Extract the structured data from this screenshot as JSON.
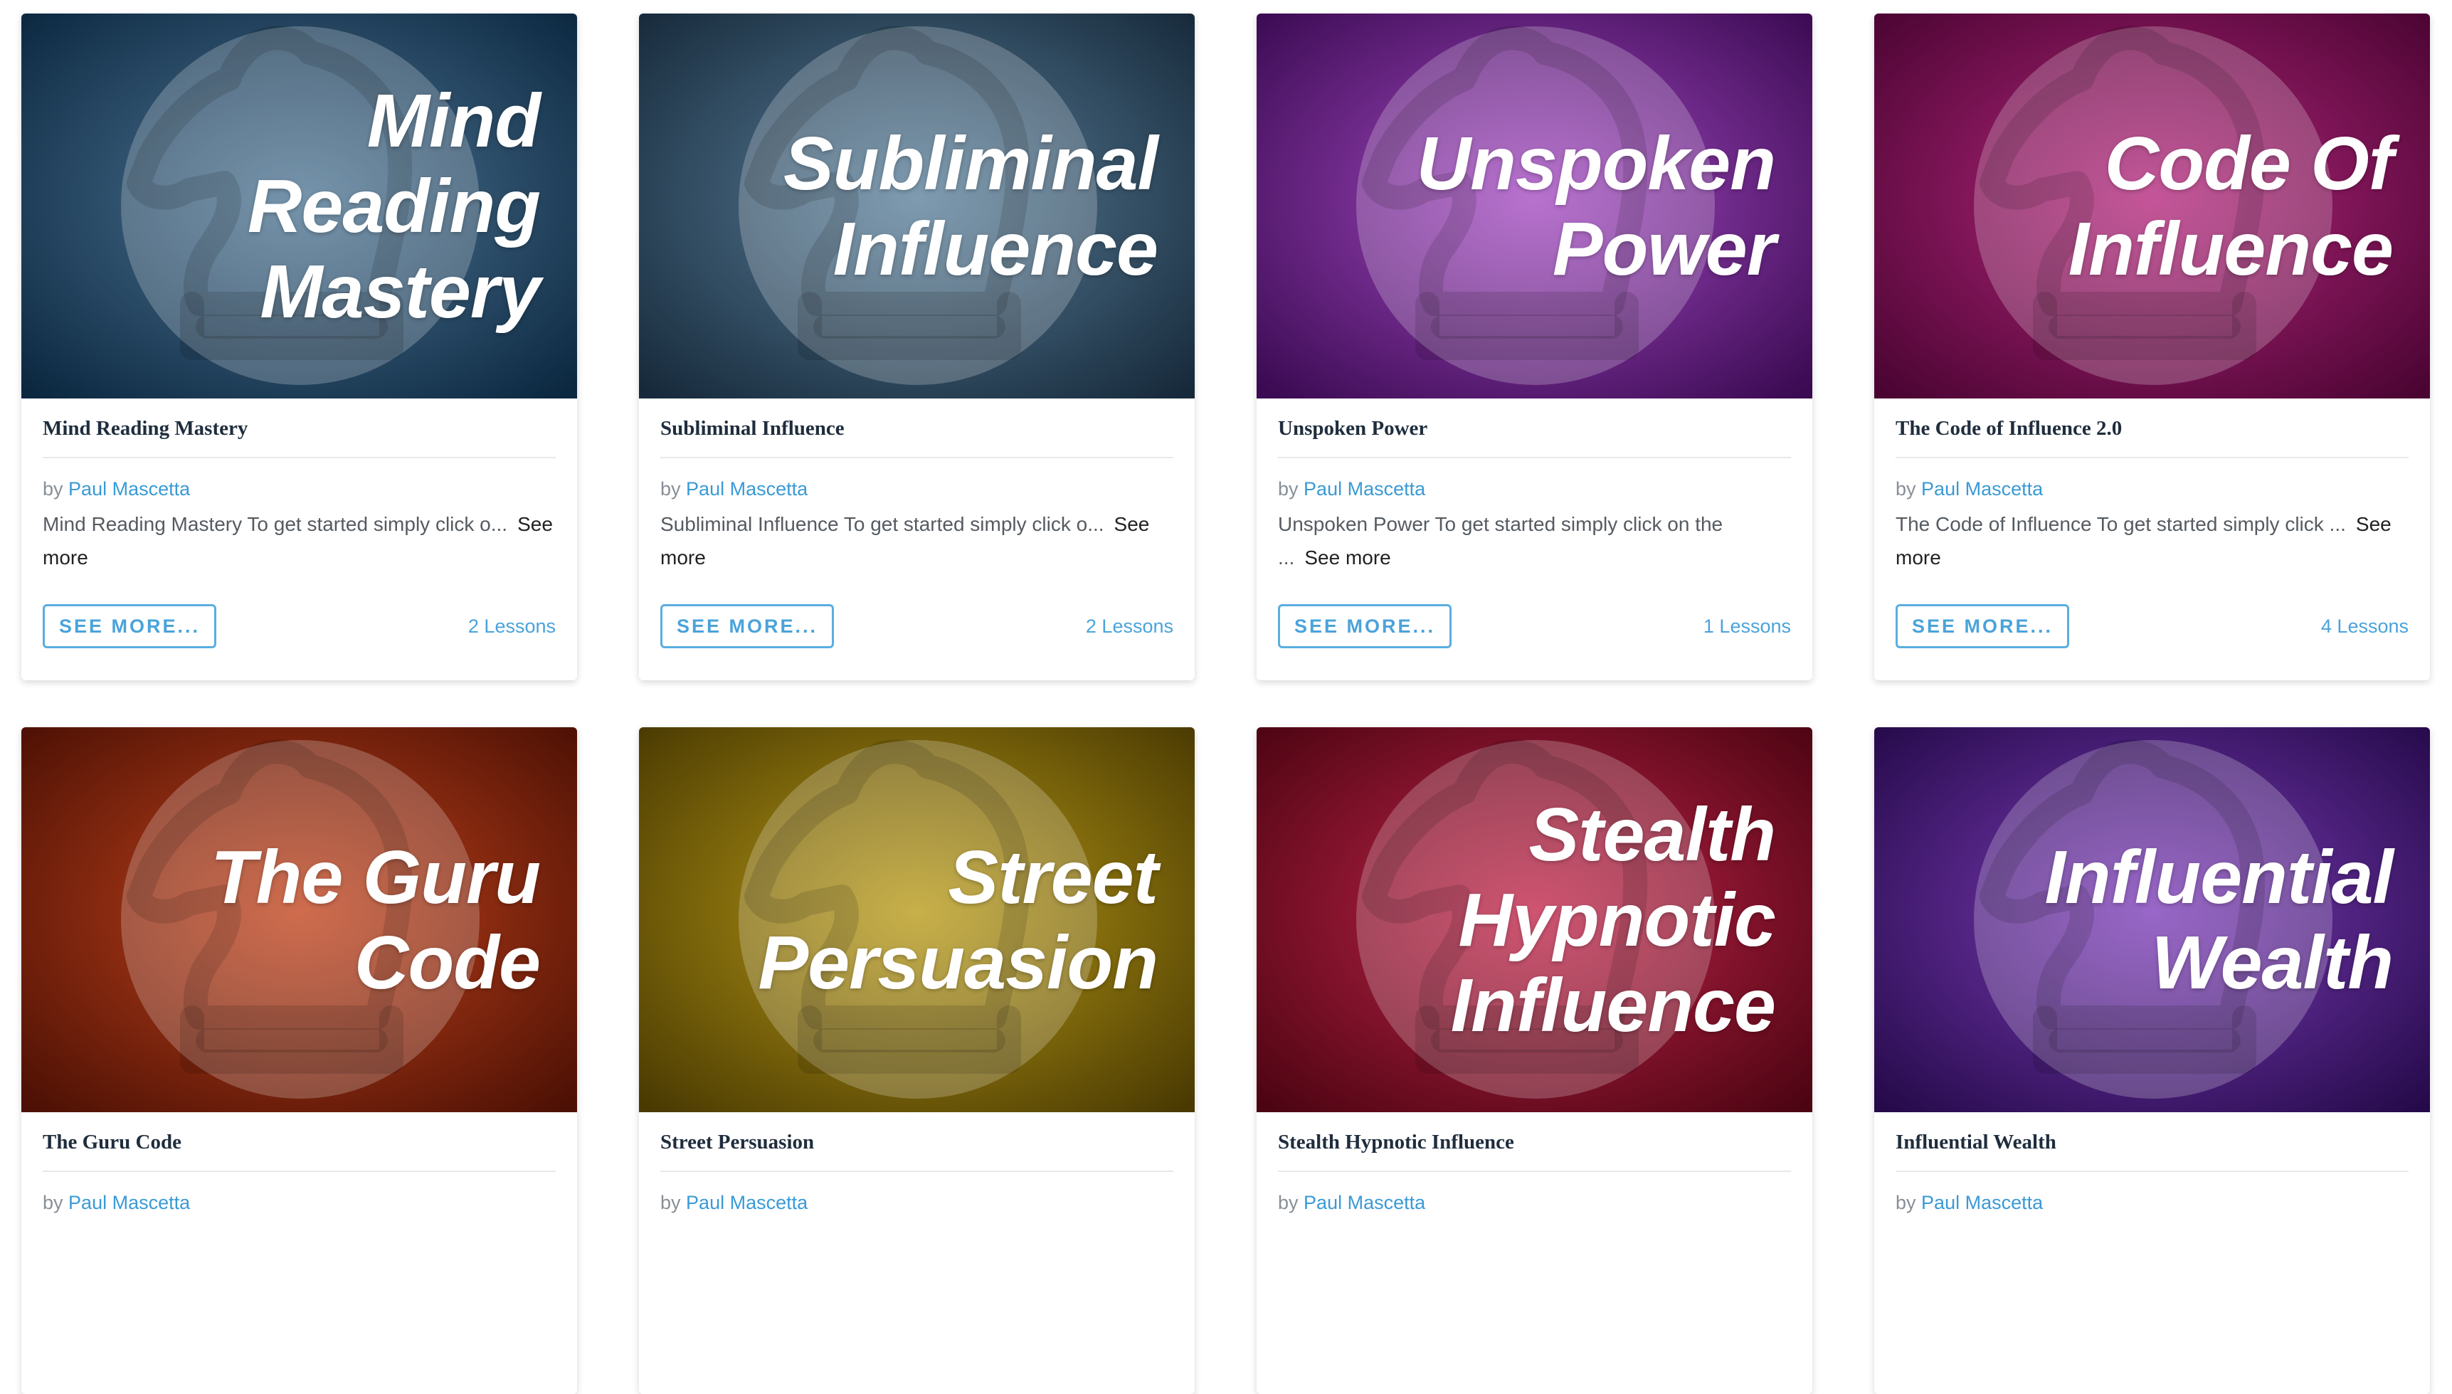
{
  "courses": [
    {
      "cover_text": "Mind\nReading\nMastery",
      "cover_colors": [
        "#4f7694",
        "#0b2740"
      ],
      "title": "Mind Reading Mastery",
      "by": "by",
      "author": "Paul Mascetta",
      "excerpt": "Mind Reading Mastery To get started simply click o...",
      "see_more_link": "See more",
      "button_label": "SEE MORE...",
      "lessons": "2 Lessons"
    },
    {
      "cover_text": "Subliminal\nInfluence",
      "cover_colors": [
        "#5a7f9a",
        "#16293a"
      ],
      "title": "Subliminal Influence",
      "by": "by",
      "author": "Paul Mascetta",
      "excerpt": "Subliminal Influence To get started simply click o...",
      "see_more_link": "See more",
      "button_label": "SEE MORE...",
      "lessons": "2 Lessons"
    },
    {
      "cover_text": "Unspoken\nPower",
      "cover_colors": [
        "#a44ac2",
        "#3a0a52"
      ],
      "title": "Unspoken Power",
      "by": "by",
      "author": "Paul Mascetta",
      "excerpt": "Unspoken Power To get started simply click on the ...",
      "see_more_link": "See more",
      "button_label": "SEE MORE...",
      "lessons": "1 Lessons"
    },
    {
      "cover_text": "Code Of\nInfluence",
      "cover_colors": [
        "#b4267c",
        "#4a0432"
      ],
      "title": "The Code of Influence 2.0",
      "by": "by",
      "author": "Paul Mascetta",
      "excerpt": "The Code of Influence To get started simply click ...",
      "see_more_link": "See more",
      "button_label": "SEE MORE...",
      "lessons": "4 Lessons"
    },
    {
      "cover_text": "The Guru\nCode",
      "cover_colors": [
        "#c2431c",
        "#4c1004"
      ],
      "title": "The Guru Code",
      "by": "by",
      "author": "Paul Mascetta",
      "excerpt": "",
      "see_more_link": "",
      "button_label": "",
      "lessons": ""
    },
    {
      "cover_text": "Street\nPersuasion",
      "cover_colors": [
        "#b89a16",
        "#4a3a02"
      ],
      "title": "Street Persuasion",
      "by": "by",
      "author": "Paul Mascetta",
      "excerpt": "",
      "see_more_link": "",
      "button_label": "",
      "lessons": ""
    },
    {
      "cover_text": "Stealth\nHypnotic\nInfluence",
      "cover_colors": [
        "#c2244a",
        "#4c0412"
      ],
      "title": "Stealth Hypnotic Influence",
      "by": "by",
      "author": "Paul Mascetta",
      "excerpt": "",
      "see_more_link": "",
      "button_label": "",
      "lessons": ""
    },
    {
      "cover_text": "Influential\nWealth",
      "cover_colors": [
        "#7c3cb8",
        "#250a4a"
      ],
      "title": "Influential Wealth",
      "by": "by",
      "author": "Paul Mascetta",
      "excerpt": "",
      "see_more_link": "",
      "button_label": "",
      "lessons": ""
    }
  ],
  "icons": {
    "cover": "chess-knight-icon"
  }
}
